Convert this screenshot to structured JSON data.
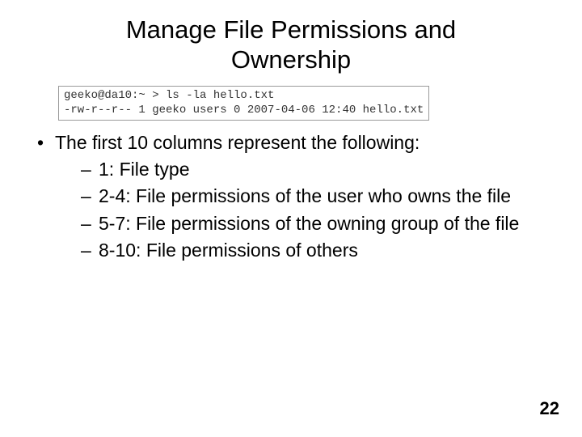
{
  "title_line1": "Manage File Permissions and",
  "title_line2": "Ownership",
  "terminal": {
    "line1": "geeko@da10:~ > ls -la hello.txt",
    "line2": "-rw-r--r-- 1 geeko users 0 2007-04-06 12:40 hello.txt"
  },
  "bullet_main": "The first 10 columns represent the following:",
  "subitems": [
    "1: File type",
    "2-4: File permissions of the user who owns the file",
    "5-7: File permissions of the owning group of the file",
    "8-10: File permissions of others"
  ],
  "page_number": "22"
}
